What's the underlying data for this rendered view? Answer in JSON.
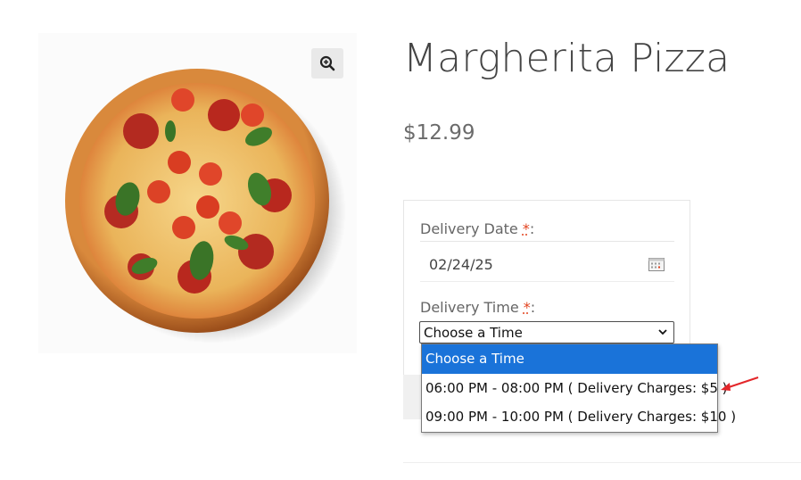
{
  "product": {
    "title": "Margherita Pizza",
    "price": "$12.99"
  },
  "icons": {
    "zoom": "zoom-in-icon",
    "calendar": "calendar-icon",
    "chevron": "chevron-down-icon"
  },
  "form": {
    "date_label": "Delivery Date",
    "date_required": "*",
    "date_suffix": ":",
    "date_value": "02/24/25",
    "time_label": "Delivery Time",
    "time_required": "*",
    "time_suffix": ":",
    "time_selected": "Choose a Time"
  },
  "dropdown": {
    "options": [
      "Choose a Time",
      "06:00 PM - 08:00 PM ( Delivery Charges: $5 )",
      "09:00 PM - 10:00 PM ( Delivery Charges: $10 )"
    ]
  },
  "colors": {
    "highlight": "#1a73d9",
    "required": "#e2401c",
    "annotation_arrow": "#e3262a"
  }
}
